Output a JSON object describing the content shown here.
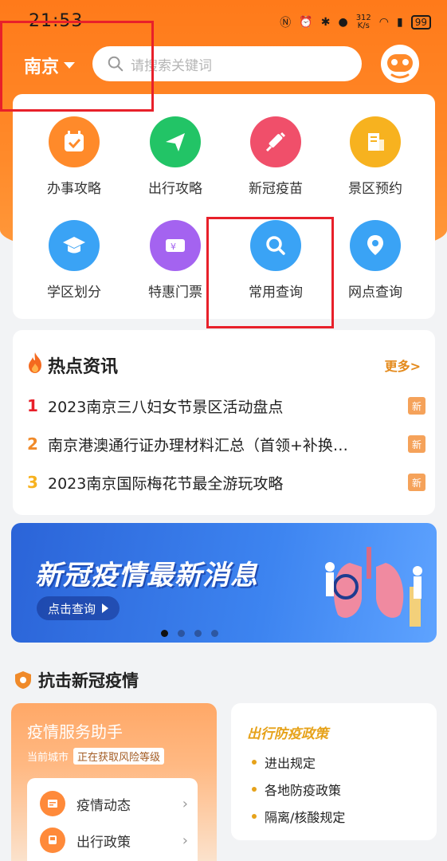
{
  "status_bar": {
    "time": "21:53",
    "speed": "312\nK/s",
    "battery": "99"
  },
  "header": {
    "city": "南京",
    "search_placeholder": "请搜索关键词"
  },
  "services": [
    {
      "label": "办事攻略",
      "icon": "calendar-check-icon",
      "color": "#ff8a2a"
    },
    {
      "label": "出行攻略",
      "icon": "paper-plane-icon",
      "color": "#22c466"
    },
    {
      "label": "新冠疫苗",
      "icon": "syringe-icon",
      "color": "#f04f6a"
    },
    {
      "label": "景区预约",
      "icon": "building-icon",
      "color": "#f7b21f"
    },
    {
      "label": "学区划分",
      "icon": "graduation-cap-icon",
      "color": "#3aa3f5"
    },
    {
      "label": "特惠门票",
      "icon": "ticket-icon",
      "color": "#a463f0"
    },
    {
      "label": "常用查询",
      "icon": "search-icon",
      "color": "#3aa3f5"
    },
    {
      "label": "网点查询",
      "icon": "location-pin-icon",
      "color": "#3aa3f5"
    }
  ],
  "hot_news": {
    "title": "热点资讯",
    "more": "更多>",
    "items": [
      {
        "num": "1",
        "text": "2023南京三八妇女节景区活动盘点",
        "badge": "新",
        "num_color": "#e8202a"
      },
      {
        "num": "2",
        "text": "南京港澳通行证办理材料汇总（首领+补换…",
        "badge": "新",
        "num_color": "#f08a2a"
      },
      {
        "num": "3",
        "text": "2023南京国际梅花节最全游玩攻略",
        "badge": "新",
        "num_color": "#f7b21f"
      }
    ]
  },
  "banner": {
    "title": "新冠疫情最新消息",
    "button": "点击查询",
    "dots": 4,
    "active_dot": 0
  },
  "covid_section": {
    "title": "抗击新冠疫情",
    "assistant": {
      "title": "疫情服务助手",
      "current_city_label": "当前城市",
      "risk_status": "正在获取风险等级",
      "rows": [
        {
          "label": "疫情动态"
        },
        {
          "label": "出行政策"
        }
      ]
    },
    "policy": {
      "title": "出行防疫政策",
      "items": [
        "进出规定",
        "各地防疫政策",
        "隔离/核酸规定"
      ]
    }
  }
}
